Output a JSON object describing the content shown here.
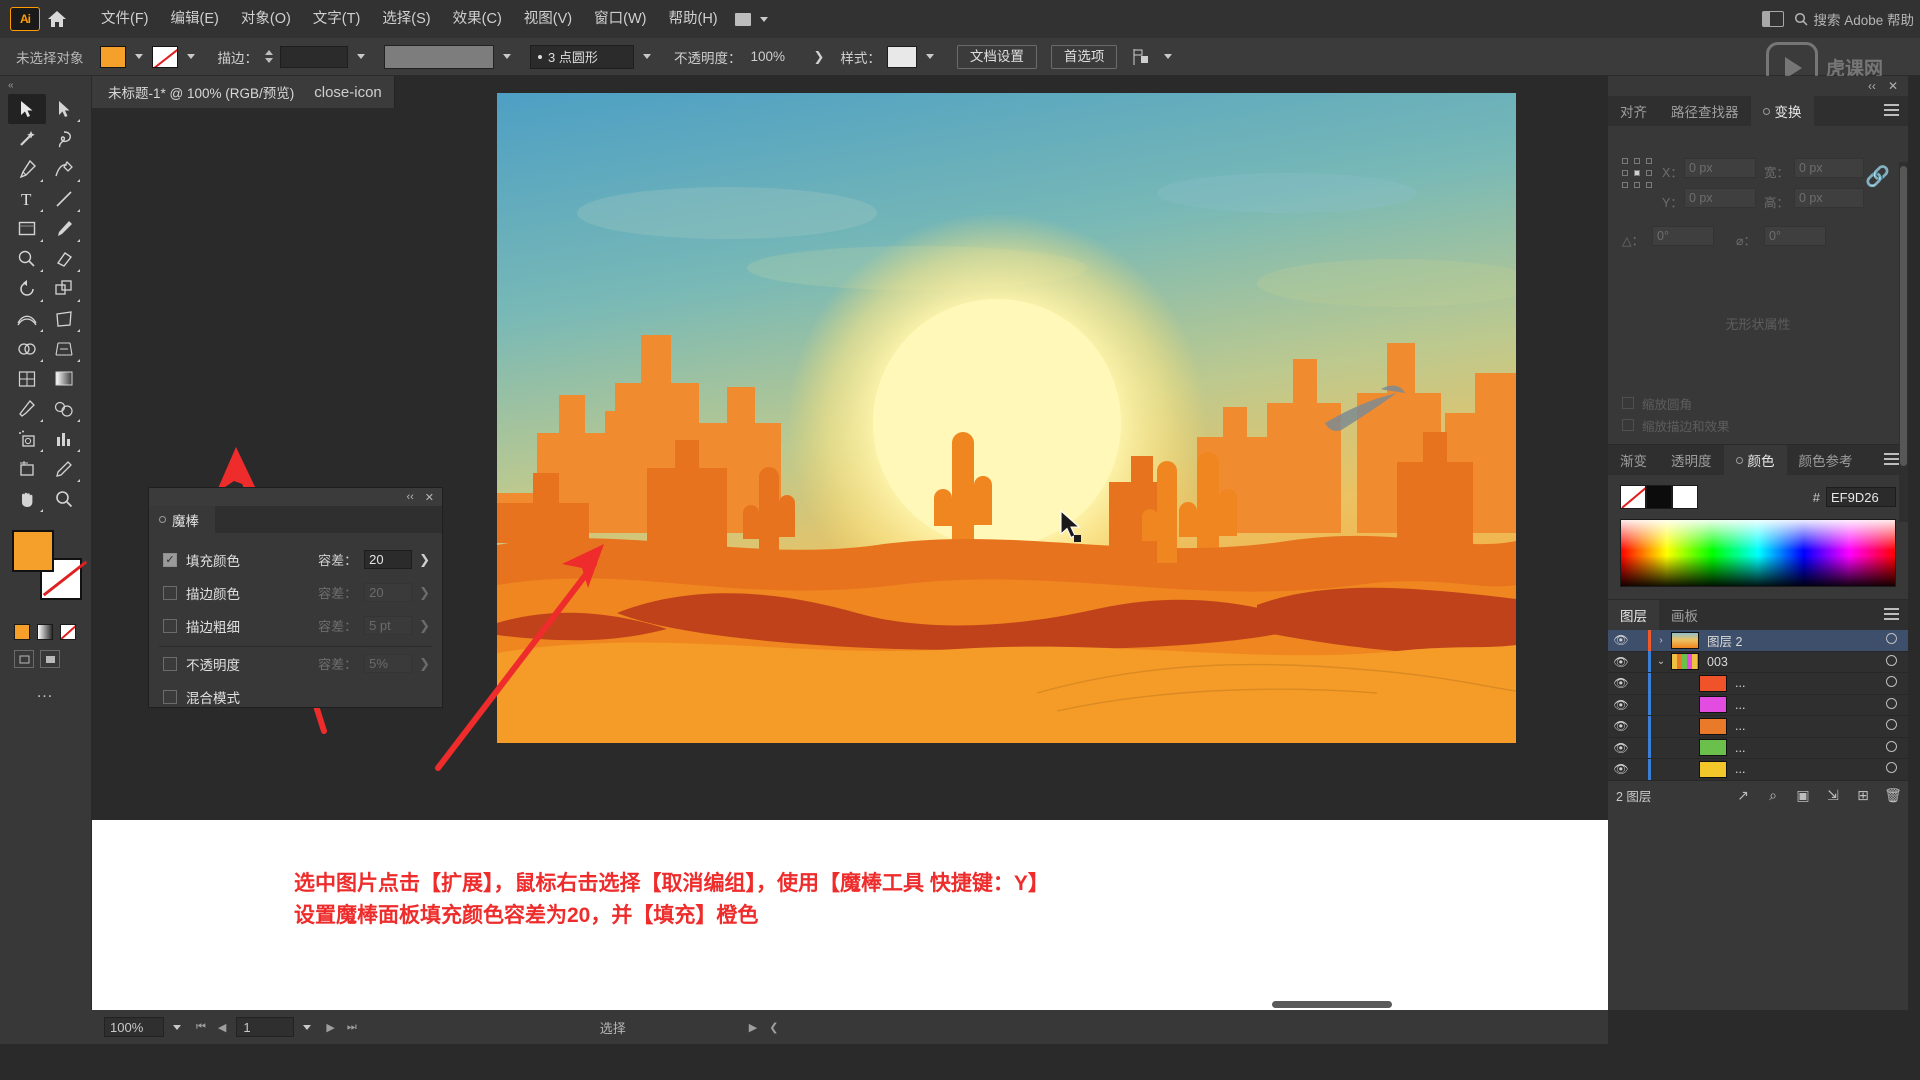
{
  "app": {
    "name": "Ai",
    "logo_text": "Ai"
  },
  "menubar": {
    "items": [
      "文件(F)",
      "编辑(E)",
      "对象(O)",
      "文字(T)",
      "选择(S)",
      "效果(C)",
      "视图(V)",
      "窗口(W)",
      "帮助(H)"
    ],
    "search_placeholder": "搜索 Adobe 帮助",
    "home_icon": "home-icon",
    "workspace_icon": "workspace-switcher-icon"
  },
  "controlbar": {
    "status_label": "未选择对象",
    "fill_color": "#F4A02A",
    "stroke_color": "#FFFFFF",
    "stroke_label": "描边：",
    "stroke_weight": "",
    "brush_label": "3 点圆形",
    "opacity_label": "不透明度：",
    "opacity_value": "100%",
    "style_label": "样式：",
    "doc_setup_label": "文档设置",
    "preferences_label": "首选项",
    "align_icon": "align-objects-icon"
  },
  "tab": {
    "title": "未标题-1* @ 100% (RGB/预览)",
    "close_icon": "close-icon"
  },
  "toolbox": {
    "handle": "«",
    "tools": [
      {
        "name": "selection-tool",
        "selected": true
      },
      {
        "name": "direct-selection-tool",
        "selected": false
      },
      {
        "name": "magic-wand-tool",
        "selected": false
      },
      {
        "name": "lasso-tool",
        "selected": false
      },
      {
        "name": "pen-tool",
        "selected": false
      },
      {
        "name": "curvature-tool",
        "selected": false
      },
      {
        "name": "type-tool",
        "selected": false
      },
      {
        "name": "line-segment-tool",
        "selected": false
      },
      {
        "name": "rectangle-tool",
        "selected": false
      },
      {
        "name": "paintbrush-tool",
        "selected": false
      },
      {
        "name": "shaper-tool",
        "selected": false
      },
      {
        "name": "eraser-tool",
        "selected": false
      },
      {
        "name": "rotate-tool",
        "selected": false
      },
      {
        "name": "scale-tool",
        "selected": false
      },
      {
        "name": "width-tool",
        "selected": false
      },
      {
        "name": "free-transform-tool",
        "selected": false
      },
      {
        "name": "shape-builder-tool",
        "selected": false
      },
      {
        "name": "perspective-grid-tool",
        "selected": false
      },
      {
        "name": "mesh-tool",
        "selected": false
      },
      {
        "name": "gradient-tool",
        "selected": false
      },
      {
        "name": "eyedropper-tool",
        "selected": false
      },
      {
        "name": "blend-tool",
        "selected": false
      },
      {
        "name": "symbol-sprayer-tool",
        "selected": false
      },
      {
        "name": "column-graph-tool",
        "selected": false
      },
      {
        "name": "artboard-tool",
        "selected": false
      },
      {
        "name": "slice-tool",
        "selected": false
      },
      {
        "name": "hand-tool",
        "selected": false
      },
      {
        "name": "zoom-tool",
        "selected": false
      }
    ],
    "more_tools": "…"
  },
  "magic_wand_panel": {
    "tab_label": "魔棒",
    "collapse_icon": "collapse-icon",
    "close_icon": "close-icon",
    "tolerance_label": "容差：",
    "rows": [
      {
        "label": "填充颜色",
        "checked": true,
        "enabled": true,
        "tolerance": "20"
      },
      {
        "label": "描边颜色",
        "checked": false,
        "enabled": false,
        "tolerance": "20"
      },
      {
        "label": "描边粗细",
        "checked": false,
        "enabled": false,
        "tolerance": "5 pt"
      },
      {
        "label": "不透明度",
        "checked": false,
        "enabled": false,
        "tolerance": "5%"
      },
      {
        "label": "混合模式",
        "checked": false,
        "enabled": false,
        "tolerance": ""
      }
    ]
  },
  "transform_panel": {
    "tabs": [
      "对齐",
      "路径查找器",
      "变换"
    ],
    "active_tab": "变换",
    "fields": [
      {
        "label": "X：",
        "value": "0 px"
      },
      {
        "label": "Y：",
        "value": "0 px"
      },
      {
        "label": "宽：",
        "value": "0 px"
      },
      {
        "label": "高：",
        "value": "0 px"
      },
      {
        "label": "△：",
        "value": "0°"
      },
      {
        "label": "⌀：",
        "value": "0°"
      }
    ],
    "empty_text": "无形状属性",
    "checkboxes": [
      "缩放圆角",
      "缩放描边和效果"
    ],
    "link_icon": "link-dimensions-icon",
    "menu_icon": "panel-menu-icon"
  },
  "color_panel": {
    "tabs": [
      "渐变",
      "透明度",
      "颜色",
      "颜色参考"
    ],
    "active_tab": "颜色",
    "hex_symbol": "#",
    "hex_value": "EF9D26",
    "fill_color": "#EF9D26",
    "menu_icon": "panel-menu-icon"
  },
  "layers_panel": {
    "tabs": [
      "图层",
      "画板"
    ],
    "active_tab": "图层",
    "rows": [
      {
        "name": "图层 2",
        "selected": true,
        "indent": 0,
        "twist": "›",
        "color": "#f05a28",
        "thumb": "artwork-thumbnail"
      },
      {
        "name": "003",
        "selected": false,
        "indent": 0,
        "twist": "⌄",
        "color": "#3a7fd5",
        "thumb": "group-thumbnail"
      },
      {
        "name": "...",
        "selected": false,
        "indent": 1,
        "twist": "",
        "color": "#3a7fd5",
        "thumb": "#f0522a"
      },
      {
        "name": "...",
        "selected": false,
        "indent": 1,
        "twist": "",
        "color": "#3a7fd5",
        "thumb": "#e34ce0"
      },
      {
        "name": "...",
        "selected": false,
        "indent": 1,
        "twist": "",
        "color": "#3a7fd5",
        "thumb": "#e87a2a"
      },
      {
        "name": "...",
        "selected": false,
        "indent": 1,
        "twist": "",
        "color": "#3a7fd5",
        "thumb": "#6ac04a"
      },
      {
        "name": "...",
        "selected": false,
        "indent": 1,
        "twist": "",
        "color": "#3a7fd5",
        "thumb": "#f2c72a"
      }
    ],
    "footer_count": "2 图层",
    "footer_icons": [
      "locate-object-icon",
      "search-icon",
      "make-clipping-mask-icon",
      "create-sublayer-icon",
      "new-layer-icon",
      "delete-layer-icon"
    ]
  },
  "statusbar": {
    "zoom": "100%",
    "page": "1",
    "tool_status": "选择",
    "first_icon": "first-page-icon",
    "prev_icon": "prev-page-icon",
    "next_icon": "next-page-icon",
    "last_icon": "last-page-icon"
  },
  "annotation": {
    "line1": "选中图片点击【扩展】，鼠标右击选择【取消编组】，使用【魔棒工具 快捷键：Y】",
    "line2": "设置魔棒面板填充颜色容差为20，并【填充】橙色",
    "color": "#EE2C2C",
    "arrows": 2
  },
  "artwork": {
    "title": "desert-sunset-illustration",
    "sky_top": "#5BA8C4",
    "sun": "#FFF4A8",
    "sand": "#F59B28",
    "cactus": "#E8671B",
    "mesa": "#D8541A"
  },
  "watermark": {
    "text": "虎课网",
    "icon": "play-badge-icon"
  }
}
